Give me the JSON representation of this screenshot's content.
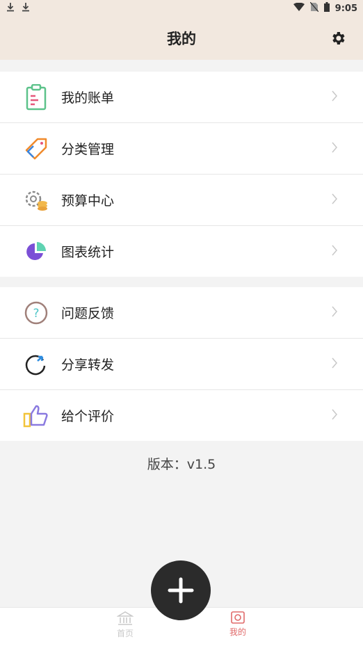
{
  "status_bar": {
    "time": "9:05"
  },
  "header": {
    "title": "我的"
  },
  "menu_group_1": [
    {
      "label": "我的账单",
      "icon": "clipboard-icon"
    },
    {
      "label": "分类管理",
      "icon": "tag-icon"
    },
    {
      "label": "预算中心",
      "icon": "budget-gear-coins-icon"
    },
    {
      "label": "图表统计",
      "icon": "pie-chart-icon"
    }
  ],
  "menu_group_2": [
    {
      "label": "问题反馈",
      "icon": "question-circle-icon"
    },
    {
      "label": "分享转发",
      "icon": "share-arrow-icon"
    },
    {
      "label": "给个评价",
      "icon": "thumbs-up-icon"
    }
  ],
  "version": "版本：v1.5",
  "bottom_nav": {
    "home_label": "首页",
    "mine_label": "我的"
  },
  "colors": {
    "header_bg": "#f2e8df",
    "active_tab": "#e06a6a",
    "fab": "#2b2b2b"
  }
}
